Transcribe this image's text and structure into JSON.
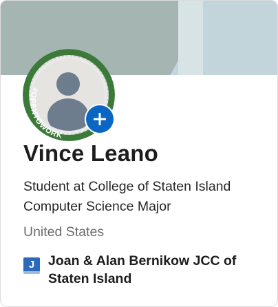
{
  "profile": {
    "name": "Vince Leano",
    "headline": "Student at College of Staten Island Computer Science Major",
    "location": "United States",
    "open_to_work_badge": "#OPENTOWORK",
    "add_icon": "plus-icon"
  },
  "company": {
    "name": "Joan & Alan Bernikow JCC of Staten Island",
    "logo_letter": "J"
  },
  "colors": {
    "accent": "#0a66c2",
    "open_to_work_green": "#3c7a3a",
    "banner_gray": "#a5b5b2",
    "banner_blue": "#c2d5da"
  }
}
